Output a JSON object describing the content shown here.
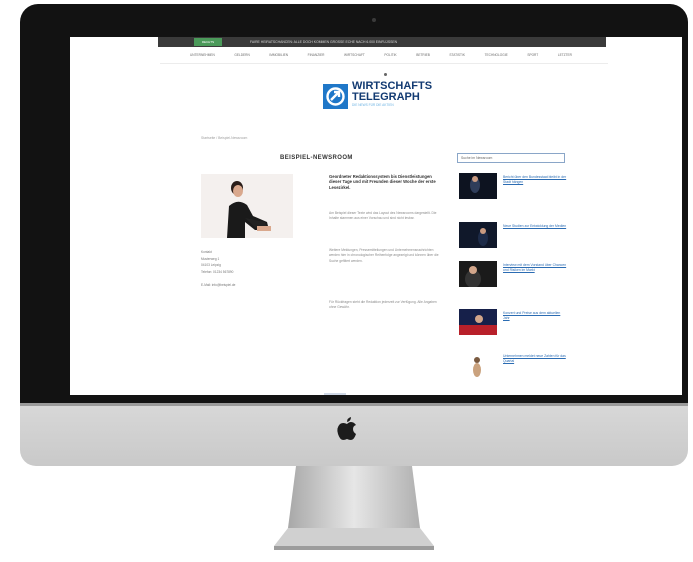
{
  "site": {
    "topbar": {
      "tag": "RECHTS",
      "ticker": "FAIRE HEIRATSCHANCEN: ALLE DOCH KOMMEN GROSSE ECHE NACH 6.000 EINFLÜSSEN"
    },
    "nav": [
      "UNTERNEHMEN",
      "GELDERN",
      "IMMOBILIEN",
      "FINANZIER",
      "WIRTSCHAFT",
      "POLITIK",
      "BETRIEB",
      "STATISTIK",
      "TECHNOLOGIE",
      "SPORT",
      "LETZTER"
    ],
    "logo": {
      "line1": "WIRTSCHAFTS",
      "line2": "TELEGRAPH",
      "tagline": "DIE NEWS FÜR DIE AKTIEN"
    },
    "breadcrumb": "Startseite  /  Beispiel-Newsroom",
    "heading": "BEISPIEL-NEWSROOM",
    "contact": [
      "Kontakt",
      "Musterweg 1",
      "04103 Leipzig",
      "Telefon: 01234 567890",
      "",
      "E-Mail: info@beispiel.de"
    ],
    "lead": "Geordneter Redaktionssystem bis Dienstleistungen dieser Tage und mit Freunden dieser Woche der erste Lesezirkel.",
    "paragraphs": [
      "Am Beispiel dieser Texte wird das Layout des Newsrooms dargestellt. Die Inhalte stammen aus einer Vorschau und sind nicht lesbar.",
      "Weitere Meldungen, Pressemitteilungen und Unternehmensnachrichten werden hier in chronologischer Reihenfolge angezeigt und können über die Suche gefiltert werden.",
      "Für Rückfragen steht die Redaktion jederzeit zur Verfügung. Alle Angaben ohne Gewähr."
    ],
    "search_placeholder": "Suche im Newsroom",
    "sidebar": [
      "Bericht über den Bundesstaat bleibt in der Stadt hängen",
      "Neue Studien zur Entwicklung der Medien",
      "Interview mit dem Vorstand über Chancen und Risiken im Markt",
      "Konzert und Preise aus dem aktuellen Jahr",
      "Unternehmen meldet neue Zahlen für das Quartal"
    ]
  }
}
